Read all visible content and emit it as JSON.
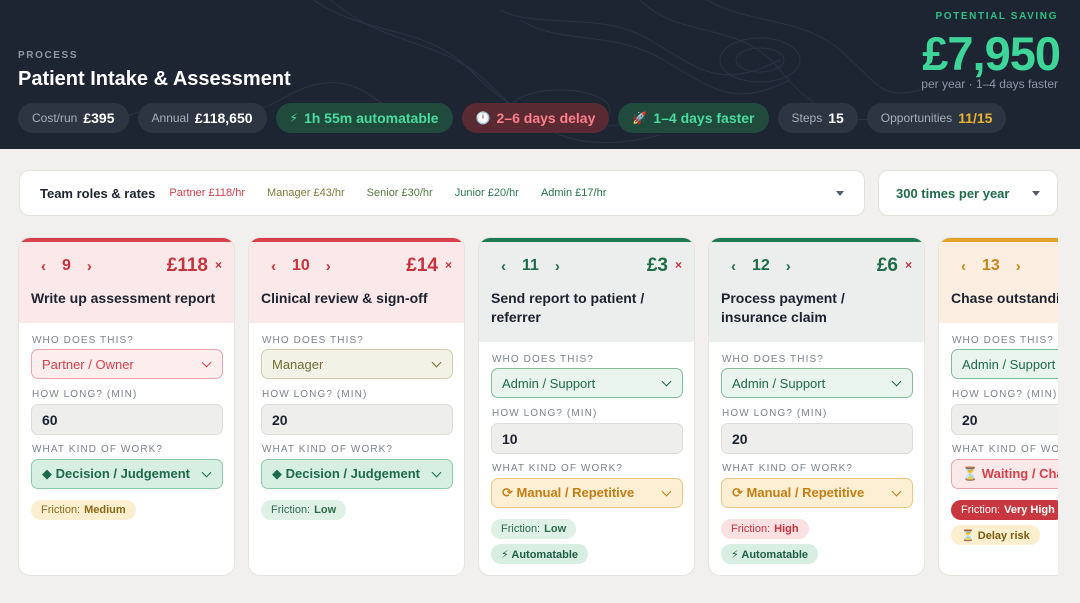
{
  "header": {
    "process_label": "PROCESS",
    "process_title": "Patient Intake & Assessment",
    "saving_label": "POTENTIAL SAVING",
    "saving_value": "£7,950",
    "saving_sub": "per year · 1–4 days faster",
    "chips": {
      "cost_label": "Cost/run",
      "cost_value": "£395",
      "annual_label": "Annual",
      "annual_value": "£118,650",
      "automatable_icon": "⚡",
      "automatable": "1h 55m automatable",
      "delay_icon": "🕛",
      "delay": "2–6 days delay",
      "faster_icon": "🚀",
      "faster": "1–4 days faster",
      "steps_label": "Steps",
      "steps_value": "15",
      "opps_label": "Opportunities",
      "opps_value": "11/15"
    }
  },
  "roles": {
    "title": "Team roles & rates",
    "partner": "Partner £118/hr",
    "manager": "Manager £43/hr",
    "senior": "Senior £30/hr",
    "junior": "Junior £20/hr",
    "admin": "Admin £17/hr"
  },
  "frequency": "300 times per year",
  "field_labels": {
    "who": "WHO DOES THIS?",
    "how_long": "HOW LONG? (MIN)",
    "kind": "WHAT KIND OF WORK?"
  },
  "cards": [
    {
      "num": "9",
      "cost": "£118",
      "title": "Write up assessment report",
      "who": "Partner / Owner",
      "minutes": "60",
      "kind": "◆ Decision / Judgement",
      "friction_label": "Friction:",
      "friction": "Medium",
      "tags": []
    },
    {
      "num": "10",
      "cost": "£14",
      "title": "Clinical review & sign-off",
      "who": "Manager",
      "minutes": "20",
      "kind": "◆ Decision / Judgement",
      "friction_label": "Friction:",
      "friction": "Low",
      "tags": []
    },
    {
      "num": "11",
      "cost": "£3",
      "title": "Send report to patient / referrer",
      "who": "Admin / Support",
      "minutes": "10",
      "kind": "⟳ Manual / Repetitive",
      "friction_label": "Friction:",
      "friction": "Low",
      "tags": [
        "⚡ Automatable"
      ]
    },
    {
      "num": "12",
      "cost": "£6",
      "title": "Process payment / insurance claim",
      "who": "Admin / Support",
      "minutes": "20",
      "kind": "⟳ Manual / Repetitive",
      "friction_label": "Friction:",
      "friction": "High",
      "tags": [
        "⚡ Automatable"
      ]
    },
    {
      "num": "13",
      "cost": "",
      "title": "Chase outstanding",
      "who": "Admin / Support",
      "minutes": "20",
      "kind": "⏳ Waiting / Cha",
      "friction_label": "Friction:",
      "friction": "Very High",
      "tags": [
        "⏳ Delay risk"
      ]
    }
  ],
  "nav": {
    "prev": "‹",
    "next": "›",
    "remove": "×"
  },
  "colors": {
    "header_bg": "#1d2533",
    "accent_green": "#3ed598",
    "red": "#d8404c",
    "green": "#1e7a52",
    "amber": "#e3a32a"
  }
}
